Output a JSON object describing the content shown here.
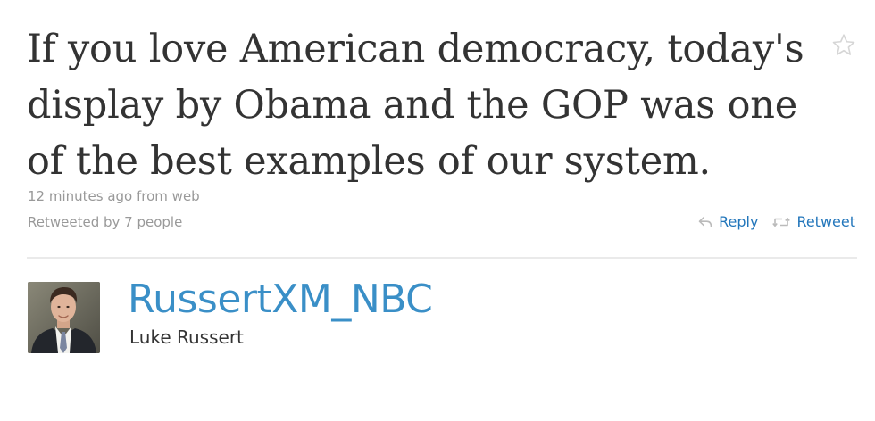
{
  "tweet": {
    "text_lines": [
      "If you love American democracy, today's",
      "display by Obama and the GOP was one",
      "of the best examples of our system."
    ],
    "timestamp": "12 minutes ago from web",
    "retweeted_by": "Retweeted by 7 people",
    "actions": {
      "reply_label": "Reply",
      "retweet_label": "Retweet"
    },
    "icons": {
      "favorite": "star-icon",
      "reply": "reply-arrow-icon",
      "retweet": "retweet-arrows-icon"
    }
  },
  "author": {
    "username": "RussertXM_NBC",
    "display_name": "Luke Russert",
    "avatar": "profile-photo"
  },
  "colors": {
    "tweet_text": "#333333",
    "meta_text": "#999999",
    "action_link": "#2276bb",
    "username": "#3a8fc7",
    "divider": "#eaeaea"
  }
}
